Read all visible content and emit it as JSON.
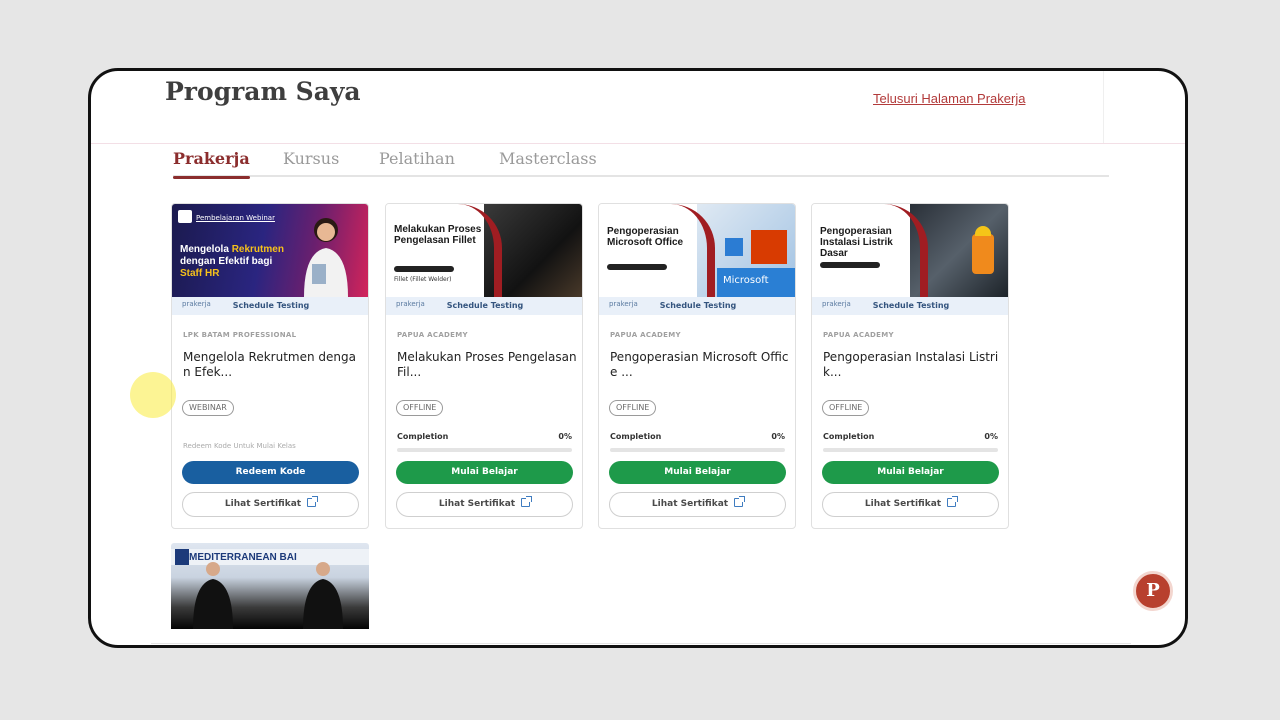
{
  "header": {
    "title": "Program Saya",
    "explore_link": "Telusuri Halaman Prakerja"
  },
  "tabs": [
    {
      "label": "Prakerja",
      "active": true
    },
    {
      "label": "Kursus",
      "active": false
    },
    {
      "label": "Pelatihan",
      "active": false
    },
    {
      "label": "Masterclass",
      "active": false
    }
  ],
  "strip_logo": "prakerja",
  "schedule_label": "Schedule Testing",
  "cards": [
    {
      "thumb_tag": "Pembelajaran Webinar",
      "thumb_line1": "Mengelola",
      "thumb_line1_highlight": "Rekrutmen",
      "thumb_line2": "dengan Efektif bagi",
      "thumb_line3": "Staff HR",
      "provider": "LPK BATAM PROFESSIONAL",
      "title": "Mengelola Rekrutmen dengan Efek...",
      "badge": "WEBINAR",
      "hint": "Redeem Kode Untuk Mulai Kelas",
      "primary_button": "Redeem Kode",
      "secondary_button": "Lihat Sertifikat"
    },
    {
      "thumb_title": "Melakukan Proses Pengelasan Fillet",
      "thumb_sub": "Fillet (Fillet Welder)",
      "provider": "PAPUA ACADEMY",
      "title": "Melakukan Proses Pengelasan Fil...",
      "badge": "OFFLINE",
      "completion_label": "Completion",
      "completion_value": "0%",
      "completion": 0,
      "primary_button": "Mulai Belajar",
      "secondary_button": "Lihat Sertifikat"
    },
    {
      "thumb_title": "Pengoperasian Microsoft Office",
      "thumb_brand": "Microsoft",
      "provider": "PAPUA ACADEMY",
      "title": "Pengoperasian Microsoft Office ...",
      "badge": "OFFLINE",
      "completion_label": "Completion",
      "completion_value": "0%",
      "completion": 0,
      "primary_button": "Mulai Belajar",
      "secondary_button": "Lihat Sertifikat"
    },
    {
      "thumb_title": "Pengoperasian Instalasi Listrik Dasar",
      "provider": "PAPUA ACADEMY",
      "title": "Pengoperasian Instalasi Listrik...",
      "badge": "OFFLINE",
      "completion_label": "Completion",
      "completion_value": "0%",
      "completion": 0,
      "primary_button": "Mulai Belajar",
      "secondary_button": "Lihat Sertifikat"
    }
  ],
  "card5": {
    "thumb_banner": "MEDITERRANEAN BAI"
  },
  "fab_letter": "P",
  "colors": {
    "brand": "#8b2d2d",
    "green": "#1e9a4a",
    "blue": "#195fa0",
    "link": "#b23a3a"
  }
}
